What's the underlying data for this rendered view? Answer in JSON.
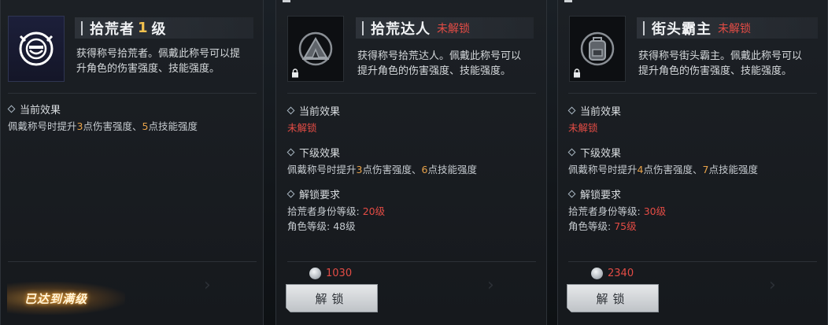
{
  "cards": [
    {
      "title": "拾荒者",
      "level": "1",
      "level_suffix": "级",
      "desc_line1": "获得称号拾荒者。佩戴此称号可以提",
      "desc_line2": "升角色的伤害强度、技能强度。",
      "current_label": "当前效果",
      "current_text": {
        "a": "佩戴称号时提升",
        "b": "3",
        "c": "点伤害强度、",
        "d": "5",
        "e": "点技能强度"
      },
      "max_badge": "已达到满级"
    },
    {
      "title": "拾荒达人",
      "locked": "未解锁",
      "desc_line1": "获得称号拾荒达人。佩戴此称号可以",
      "desc_line2": "提升角色的伤害强度、技能强度。",
      "current_label": "当前效果",
      "current_value": "未解锁",
      "next_label": "下级效果",
      "next_text": {
        "a": "佩戴称号时提升",
        "b": "3",
        "c": "点伤害强度、",
        "d": "6",
        "e": "点技能强度"
      },
      "req_label": "解锁要求",
      "req1": {
        "label": "拾荒者身份等级:",
        "value": "20级"
      },
      "req2": {
        "label": "角色等级:",
        "value": "48级"
      },
      "cost": "1030",
      "button": "解锁"
    },
    {
      "title": "街头霸主",
      "locked": "未解锁",
      "desc_line1": "获得称号街头霸主。佩戴此称号可以",
      "desc_line2": "提升角色的伤害强度、技能强度。",
      "current_label": "当前效果",
      "current_value": "未解锁",
      "next_label": "下级效果",
      "next_text": {
        "a": "佩戴称号时提升",
        "b": "4",
        "c": "点伤害强度、",
        "d": "7",
        "e": "点技能强度"
      },
      "req_label": "解锁要求",
      "req1": {
        "label": "拾荒者身份等级:",
        "value": "30级"
      },
      "req2": {
        "label": "角色等级:",
        "value": "75级"
      },
      "cost": "2340",
      "button": "解锁"
    }
  ],
  "colors": {
    "accent_red": "#e44c45",
    "accent_orange": "#e9a34a",
    "level_gold": "#f2c14e"
  },
  "icons": [
    "scavenger-emblem-icon",
    "tent-emblem-icon",
    "backpack-emblem-icon",
    "lock-icon",
    "coin-icon",
    "diamond-bullet-icon"
  ]
}
